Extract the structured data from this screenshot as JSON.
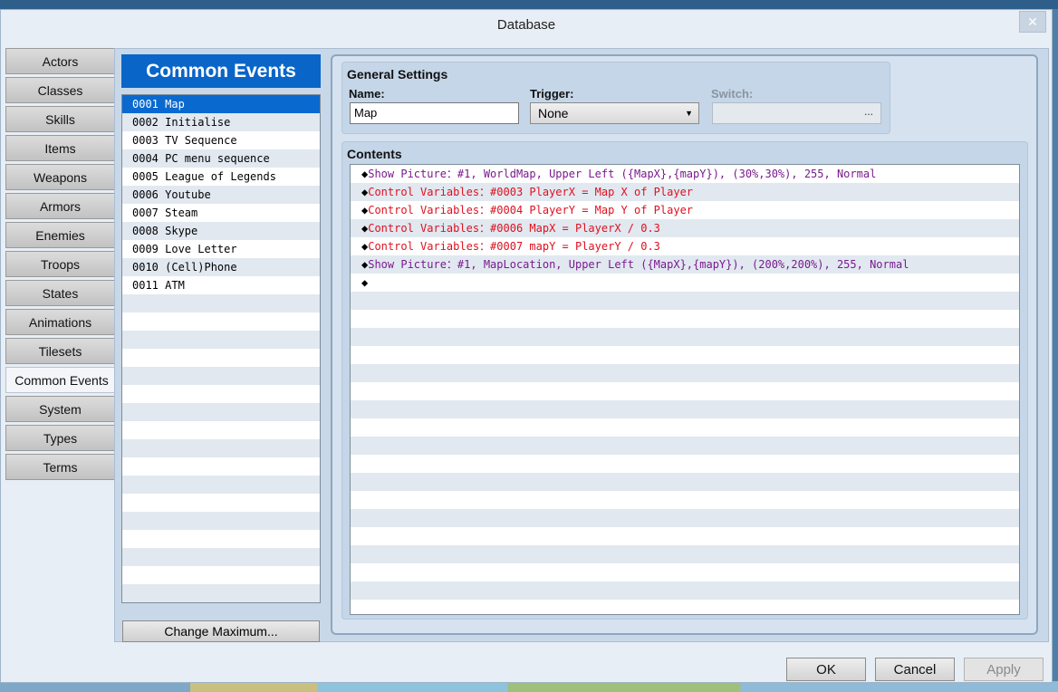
{
  "window": {
    "title": "Database",
    "close_label": "✕"
  },
  "tabs": [
    "Actors",
    "Classes",
    "Skills",
    "Items",
    "Weapons",
    "Armors",
    "Enemies",
    "Troops",
    "States",
    "Animations",
    "Tilesets",
    "Common Events",
    "System",
    "Types",
    "Terms"
  ],
  "active_tab": "Common Events",
  "list": {
    "header": "Common Events",
    "items": [
      "0001 Map",
      "0002 Initialise",
      "0003 TV Sequence",
      "0004 PC menu sequence",
      "0005 League of Legends",
      "0006 Youtube",
      "0007 Steam",
      "0008 Skype",
      "0009 Love Letter",
      "0010 (Cell)Phone",
      "0011 ATM"
    ],
    "selected_index": 0,
    "change_max_label": "Change Maximum..."
  },
  "general": {
    "title": "General Settings",
    "name_label": "Name:",
    "name_value": "Map",
    "trigger_label": "Trigger:",
    "trigger_value": "None",
    "switch_label": "Switch:",
    "switch_button": "..."
  },
  "contents": {
    "title": "Contents",
    "commands": [
      {
        "text": "Show Picture：#1, WorldMap, Upper Left ({MapX},{mapY}), (30%,30%), 255, Normal",
        "color": "#7a1a8f"
      },
      {
        "text": "Control Variables：#0003 PlayerX = Map X of Player",
        "color": "#e0101f"
      },
      {
        "text": "Control Variables：#0004 PlayerY = Map Y of Player",
        "color": "#e0101f"
      },
      {
        "text": "Control Variables：#0006 MapX = PlayerX / 0.3",
        "color": "#e0101f"
      },
      {
        "text": "Control Variables：#0007 mapY = PlayerY / 0.3",
        "color": "#e0101f"
      },
      {
        "text": "Show Picture：#1, MapLocation, Upper Left ({MapX},{mapY}), (200%,200%), 255, Normal",
        "color": "#7a1a8f"
      },
      {
        "text": "",
        "color": "#000000"
      }
    ]
  },
  "buttons": {
    "ok": "OK",
    "cancel": "Cancel",
    "apply": "Apply"
  }
}
